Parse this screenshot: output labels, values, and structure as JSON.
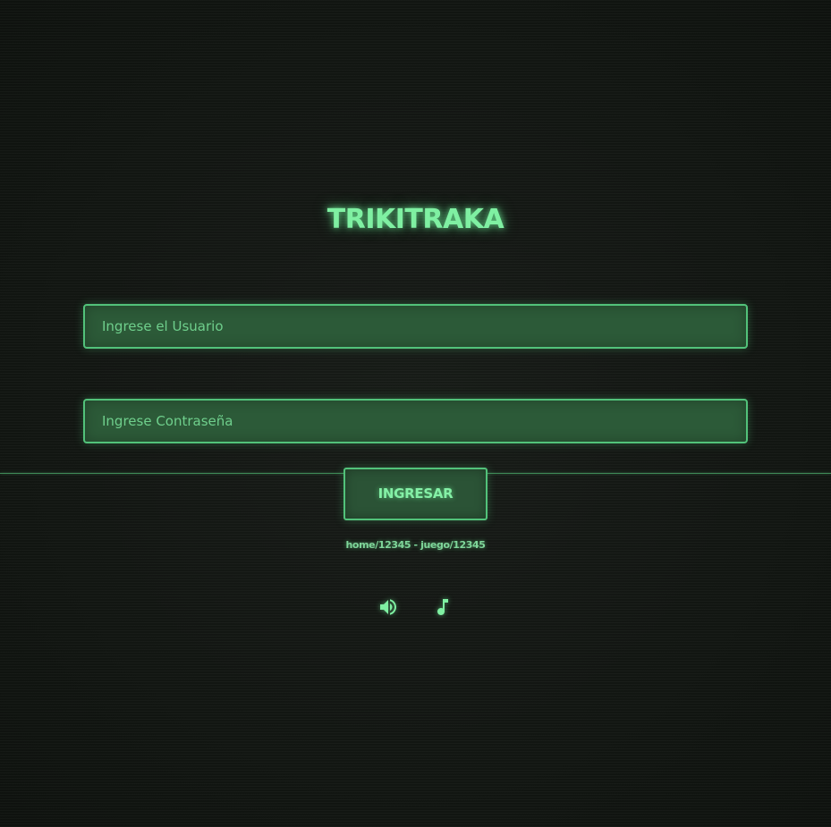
{
  "app": {
    "title": "TRIKITRAKA"
  },
  "login": {
    "username_placeholder": "Ingrese el Usuario",
    "username_value": "",
    "password_placeholder": "Ingrese Contraseña",
    "password_value": "",
    "submit_label": "INGRESAR",
    "hint": "home/12345 - juego/12345"
  },
  "controls": {
    "sound_icon": "speaker-volume-icon",
    "music_icon": "music-note-icon"
  },
  "colors": {
    "accent": "#7ff0a2",
    "border": "#52c27a",
    "field_bg": "#2c5a38",
    "background": "#141814"
  }
}
